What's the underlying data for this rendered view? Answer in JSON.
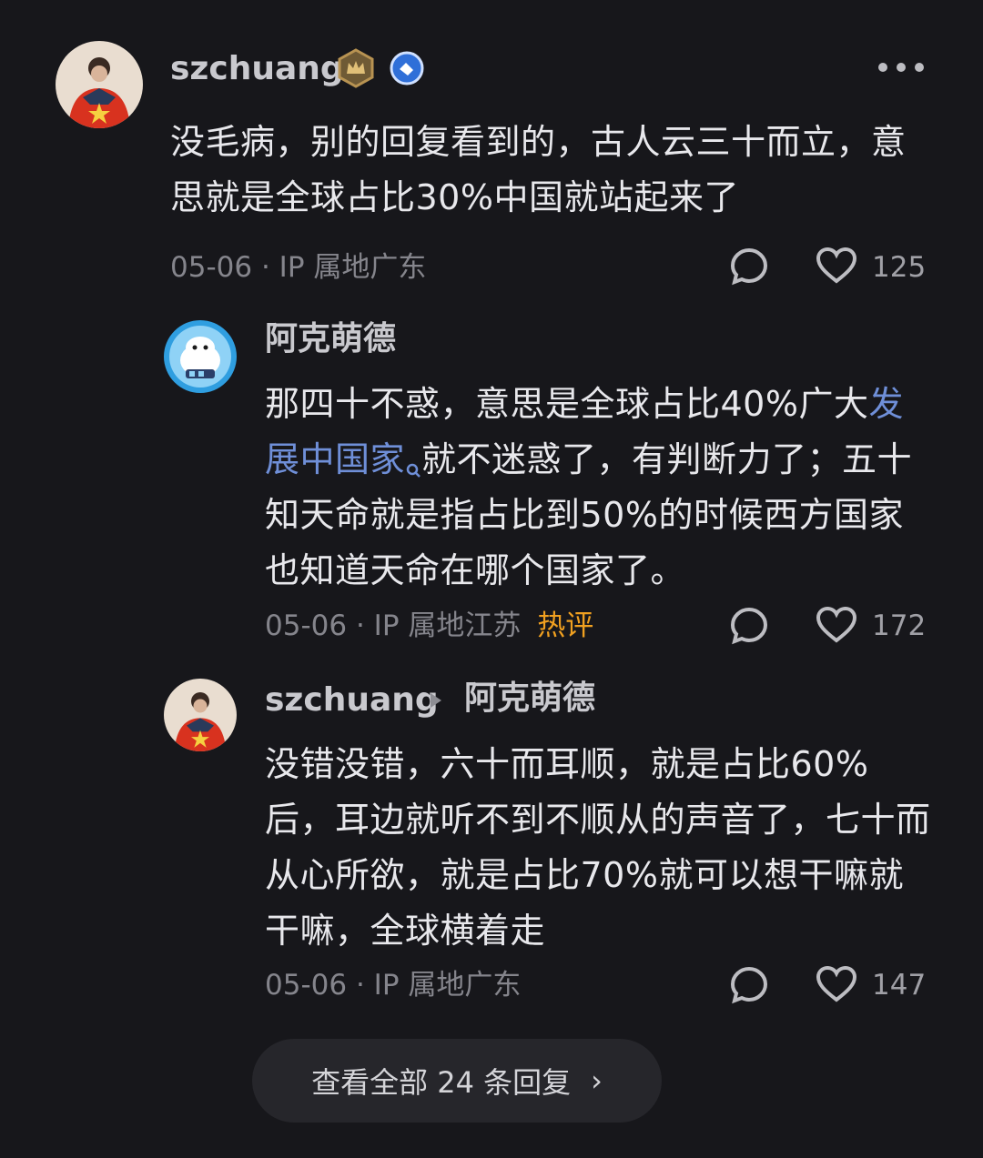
{
  "comments": [
    {
      "user": "szchuang",
      "text": "没毛病，别的回复看到的，古人云三十而立，意思就是全球占比30%中国就站起来了",
      "date": "05-06",
      "ip": "IP 属地广东",
      "likes": "125"
    }
  ],
  "replies": [
    {
      "user": "阿克萌德",
      "text_before_link": "那四十不惑，意思是全球占比40%广大",
      "link_text": "发展中国家",
      "text_after_link": "就不迷惑了，有判断力了；五十知天命就是指占比到50%的时候西方国家也知道天命在哪个国家了。",
      "date": "05-06",
      "ip": "IP 属地江苏",
      "tag": "热评",
      "likes": "172"
    },
    {
      "user": "szchuang",
      "reply_to": "阿克萌德",
      "text": "没错没错，六十而耳顺，就是占比60%后，耳边就听不到不顺从的声音了，七十而从心所欲，就是占比70%就可以想干嘛就干嘛，全球横着走",
      "date": "05-06",
      "ip": "IP 属地广东",
      "likes": "147"
    }
  ],
  "view_all": {
    "label": "查看全部 24 条回复",
    "chevron": "›"
  },
  "icons": {
    "more": "more-dots-icon",
    "reply": "reply-bubble-icon",
    "like": "heart-icon",
    "level_badge": "crown-badge-icon",
    "verified": "verified-badge-icon",
    "search_hint": "search-small-icon"
  },
  "colors": {
    "background": "#17171b",
    "link": "#6f8fd8",
    "hot_tag": "#f0a020"
  }
}
